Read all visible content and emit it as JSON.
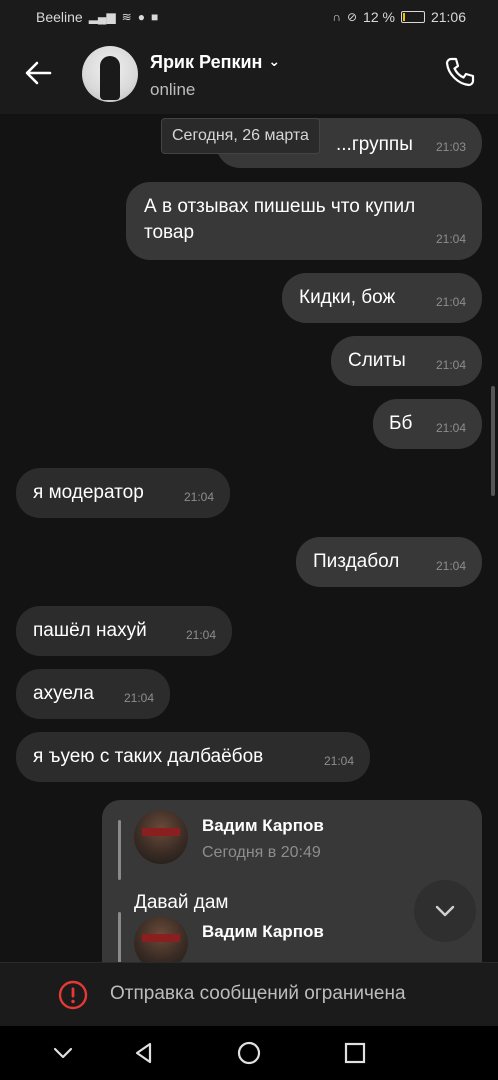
{
  "status_bar": {
    "carrier": "Beeline",
    "battery": "12 %",
    "battery_level": 0.12,
    "time": "21:06"
  },
  "header": {
    "name": "Ярик Репкин",
    "status": "online"
  },
  "date_chip": "Сегодня, 26 марта",
  "messages": [
    {
      "dir": "out",
      "text": "...группы",
      "time": "21:03"
    },
    {
      "dir": "out",
      "text": "А в отзывах пишешь что купил товар",
      "time": "21:04"
    },
    {
      "dir": "out",
      "text": "Кидки, бож",
      "time": "21:04"
    },
    {
      "dir": "out",
      "text": "Слиты",
      "time": "21:04"
    },
    {
      "dir": "out",
      "text": "Бб",
      "time": "21:04"
    },
    {
      "dir": "in",
      "text": "я модератор",
      "time": "21:04"
    },
    {
      "dir": "out",
      "text": "Пиздабол",
      "time": "21:04"
    },
    {
      "dir": "in",
      "text": "пашёл нахуй",
      "time": "21:04"
    },
    {
      "dir": "in",
      "text": "ахуела",
      "time": "21:04"
    },
    {
      "dir": "in",
      "text": "я ъуею с таких далбаёбов",
      "time": "21:04"
    }
  ],
  "forwarded": {
    "name": "Вадим Карпов",
    "time": "Сегодня в 20:49",
    "text": "Давай дам",
    "name2": "Вадим Карпов"
  },
  "restriction": {
    "text": "Отправка сообщений ограничена"
  },
  "colors": {
    "background": "#131313",
    "bubble_out": "#383838",
    "bubble_in": "#2c2c2c",
    "warning": "#e53935"
  }
}
